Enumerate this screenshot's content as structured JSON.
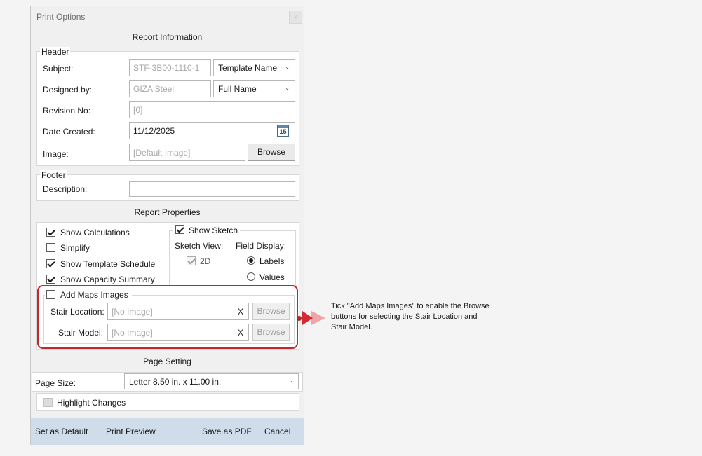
{
  "dialog": {
    "title": "Print Options",
    "close_glyph": "x"
  },
  "report_information": {
    "title": "Report Information",
    "header": {
      "legend": "Header",
      "subject_label": "Subject:",
      "subject_value": "STF-3B00-1110-1",
      "subject_combo": "Template Name",
      "designed_by_label": "Designed by:",
      "designed_by_value": "GIZA Steel",
      "designed_by_combo": "Full Name",
      "revision_label": "Revision No:",
      "revision_value": "[0]",
      "date_label": "Date Created:",
      "date_value": "11/12/2025",
      "calendar_day": "15",
      "image_label": "Image:",
      "image_value": "[Default Image]",
      "browse_label": "Browse"
    },
    "footer": {
      "legend": "Footer",
      "description_label": "Description:",
      "description_value": ""
    }
  },
  "report_properties": {
    "title": "Report Properties",
    "show_calculations": "Show Calculations",
    "simplify": "Simplify",
    "show_template_schedule": "Show Template Schedule",
    "show_capacity_summary": "Show Capacity Summary",
    "show_sketch": "Show Sketch",
    "sketch_view_label": "Sketch View:",
    "sketch_view_2d": "2D",
    "field_display_label": "Field Display:",
    "labels_option": "Labels",
    "values_option": "Values",
    "maps": {
      "legend": "Add Maps Images",
      "stair_location_label": "Stair Location:",
      "stair_location_value": "[No Image]",
      "stair_model_label": "Stair Model:",
      "stair_model_value": "[No Image]",
      "clear_glyph": "X",
      "browse_label": "Browse"
    }
  },
  "page_setting": {
    "title": "Page Setting",
    "page_size_label": "Page Size:",
    "page_size_value": "Letter 8.50 in. x 11.00 in.",
    "highlight_changes": "Highlight Changes"
  },
  "footer_bar": {
    "set_default": "Set as Default",
    "print_preview": "Print Preview",
    "save_pdf": "Save as PDF",
    "cancel": "Cancel"
  },
  "callout": {
    "text": "Tick \"Add Maps Images\" to enable the Browse buttons for selecting the Stair Location and Stair Model.",
    "accent": "#d7282f"
  }
}
